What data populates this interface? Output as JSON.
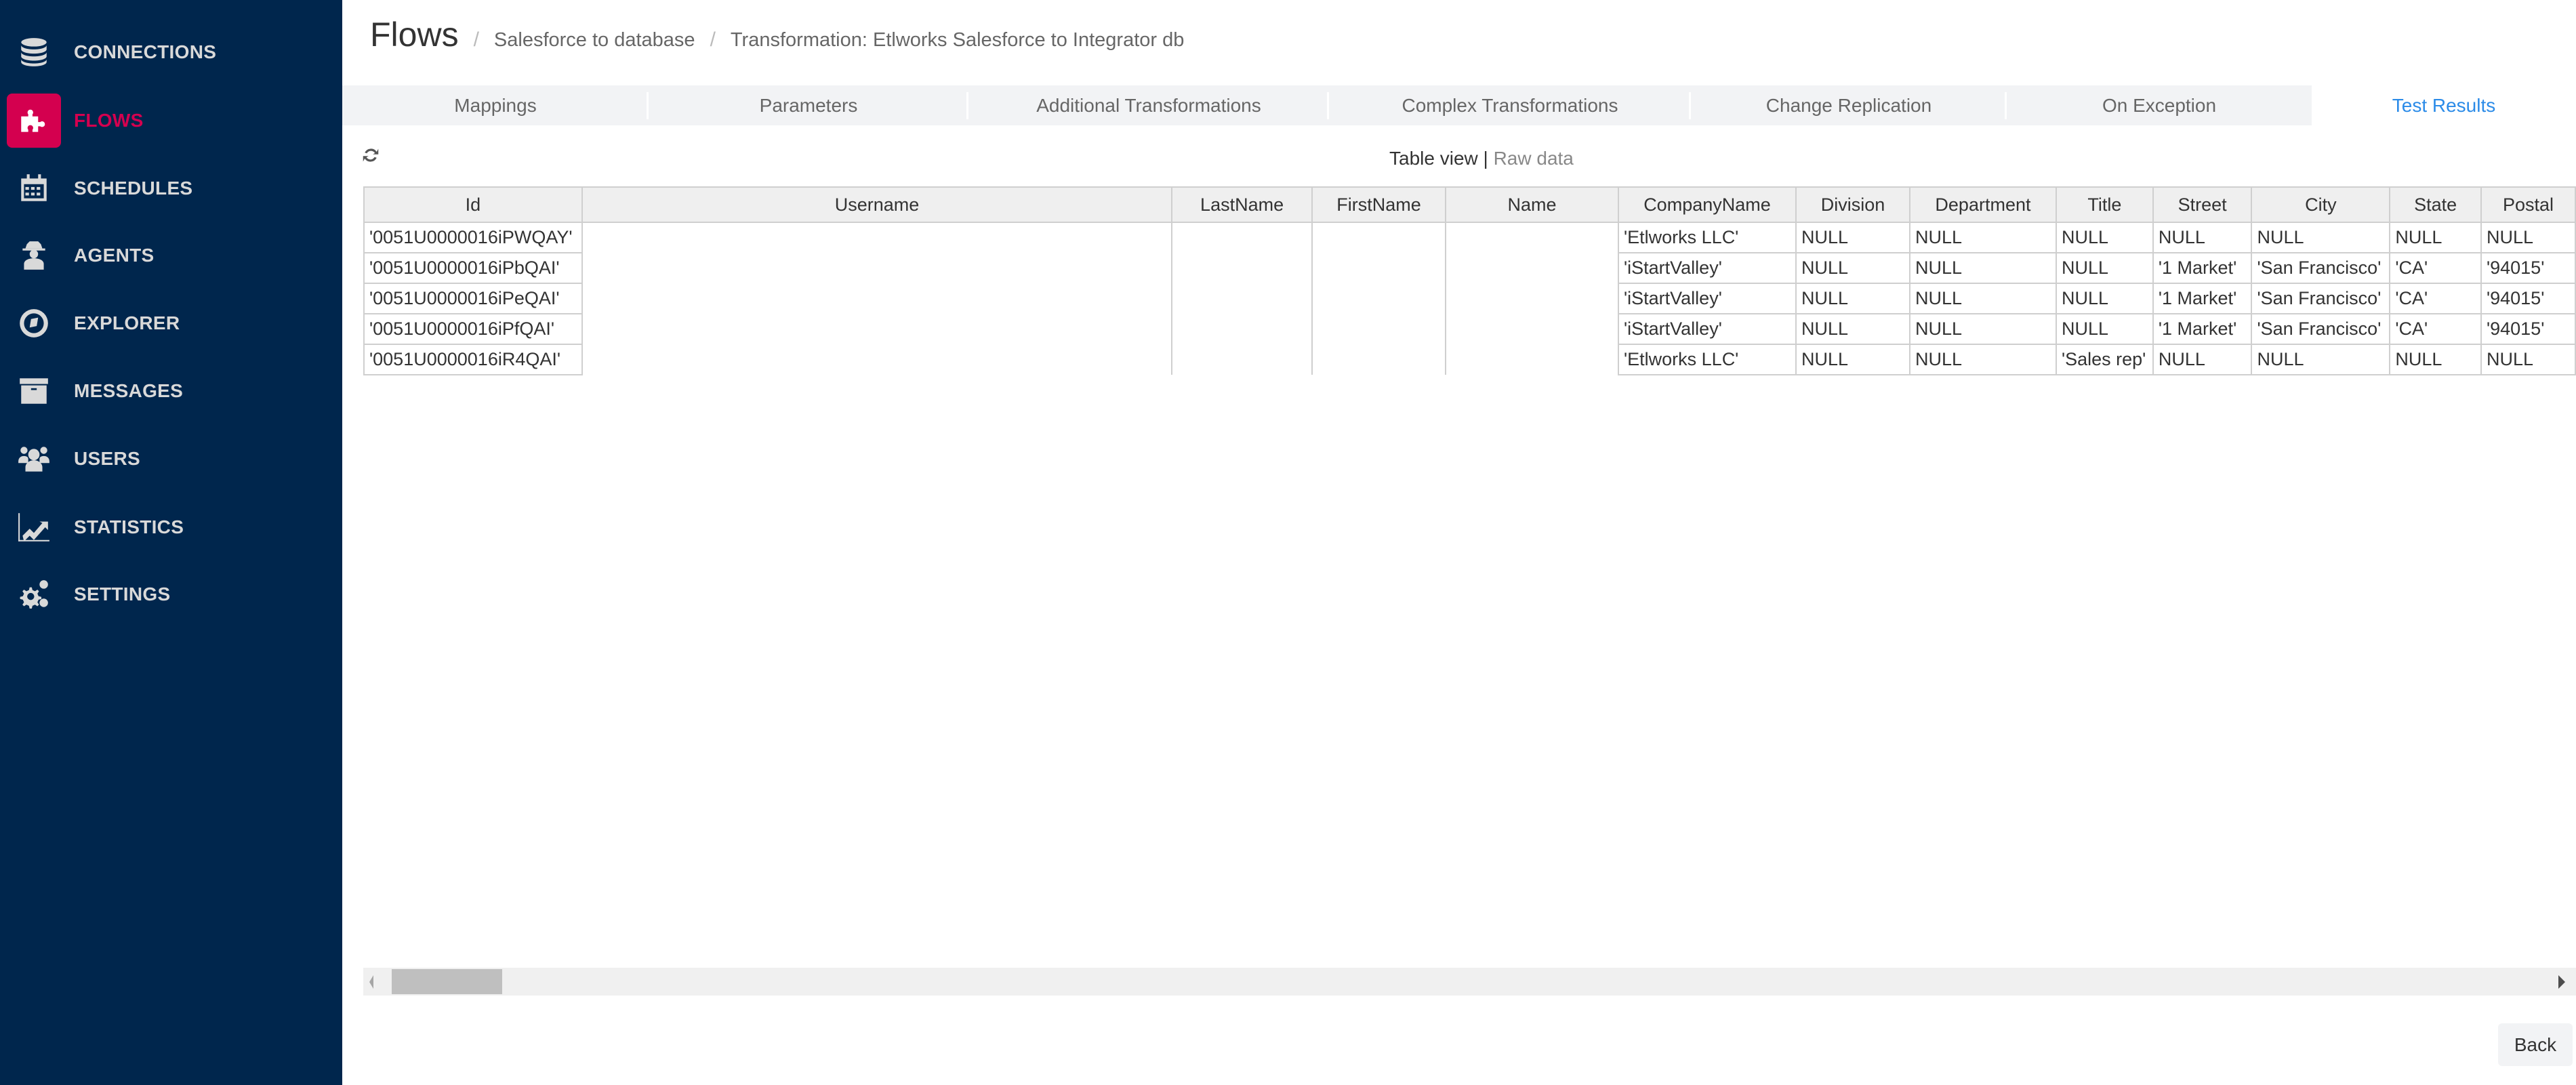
{
  "sidebar": {
    "items": [
      {
        "label": "CONNECTIONS",
        "icon": "database-icon",
        "active": false
      },
      {
        "label": "FLOWS",
        "icon": "puzzle-icon",
        "active": true
      },
      {
        "label": "SCHEDULES",
        "icon": "calendar-icon",
        "active": false
      },
      {
        "label": "AGENTS",
        "icon": "spy-agent-icon",
        "active": false
      },
      {
        "label": "EXPLORER",
        "icon": "compass-icon",
        "active": false
      },
      {
        "label": "MESSAGES",
        "icon": "archive-box-icon",
        "active": false
      },
      {
        "label": "USERS",
        "icon": "users-icon",
        "active": false
      },
      {
        "label": "STATISTICS",
        "icon": "line-chart-icon",
        "active": false
      },
      {
        "label": "SETTINGS",
        "icon": "gears-icon",
        "active": false
      }
    ],
    "active_color": "#d4004f",
    "background": "#00264d"
  },
  "header": {
    "title": "Flows",
    "separator": "/",
    "breadcrumbs": [
      "Salesforce to database",
      "Transformation: Etlworks Salesforce to Integrator db"
    ]
  },
  "tabs": [
    {
      "label": "Mappings"
    },
    {
      "label": "Parameters"
    },
    {
      "label": "Additional Transformations"
    },
    {
      "label": "Complex Transformations"
    },
    {
      "label": "Change Replication"
    },
    {
      "label": "On Exception"
    }
  ],
  "active_tab": {
    "label": "Test Results",
    "color": "#2b8be8"
  },
  "view_toggle": {
    "table_view": "Table view",
    "divider": "|",
    "raw_data": "Raw data"
  },
  "table": {
    "columns": [
      "Id",
      "Username",
      "LastName",
      "FirstName",
      "Name",
      "CompanyName",
      "Division",
      "Department",
      "Title",
      "Street",
      "City",
      "State",
      "Postal"
    ],
    "rows": [
      [
        "'0051U0000016iPWQAY'",
        "",
        "",
        "",
        "",
        "'Etlworks LLC'",
        "NULL",
        "NULL",
        "NULL",
        "NULL",
        "NULL",
        "NULL",
        "NULL"
      ],
      [
        "'0051U0000016iPbQAI'",
        "",
        "",
        "",
        "",
        "'iStartValley'",
        "NULL",
        "NULL",
        "NULL",
        "'1 Market'",
        "'San Francisco'",
        "'CA'",
        "'94015'"
      ],
      [
        "'0051U0000016iPeQAI'",
        "",
        "",
        "",
        "",
        "'iStartValley'",
        "NULL",
        "NULL",
        "NULL",
        "'1 Market'",
        "'San Francisco'",
        "'CA'",
        "'94015'"
      ],
      [
        "'0051U0000016iPfQAI'",
        "",
        "",
        "",
        "",
        "'iStartValley'",
        "NULL",
        "NULL",
        "NULL",
        "'1 Market'",
        "'San Francisco'",
        "'CA'",
        "'94015'"
      ],
      [
        "'0051U0000016iR4QAI'",
        "",
        "",
        "",
        "",
        "'Etlworks LLC'",
        "NULL",
        "NULL",
        "'Sales rep'",
        "NULL",
        "NULL",
        "NULL",
        "NULL"
      ]
    ]
  },
  "footer": {
    "back_label": "Back"
  }
}
